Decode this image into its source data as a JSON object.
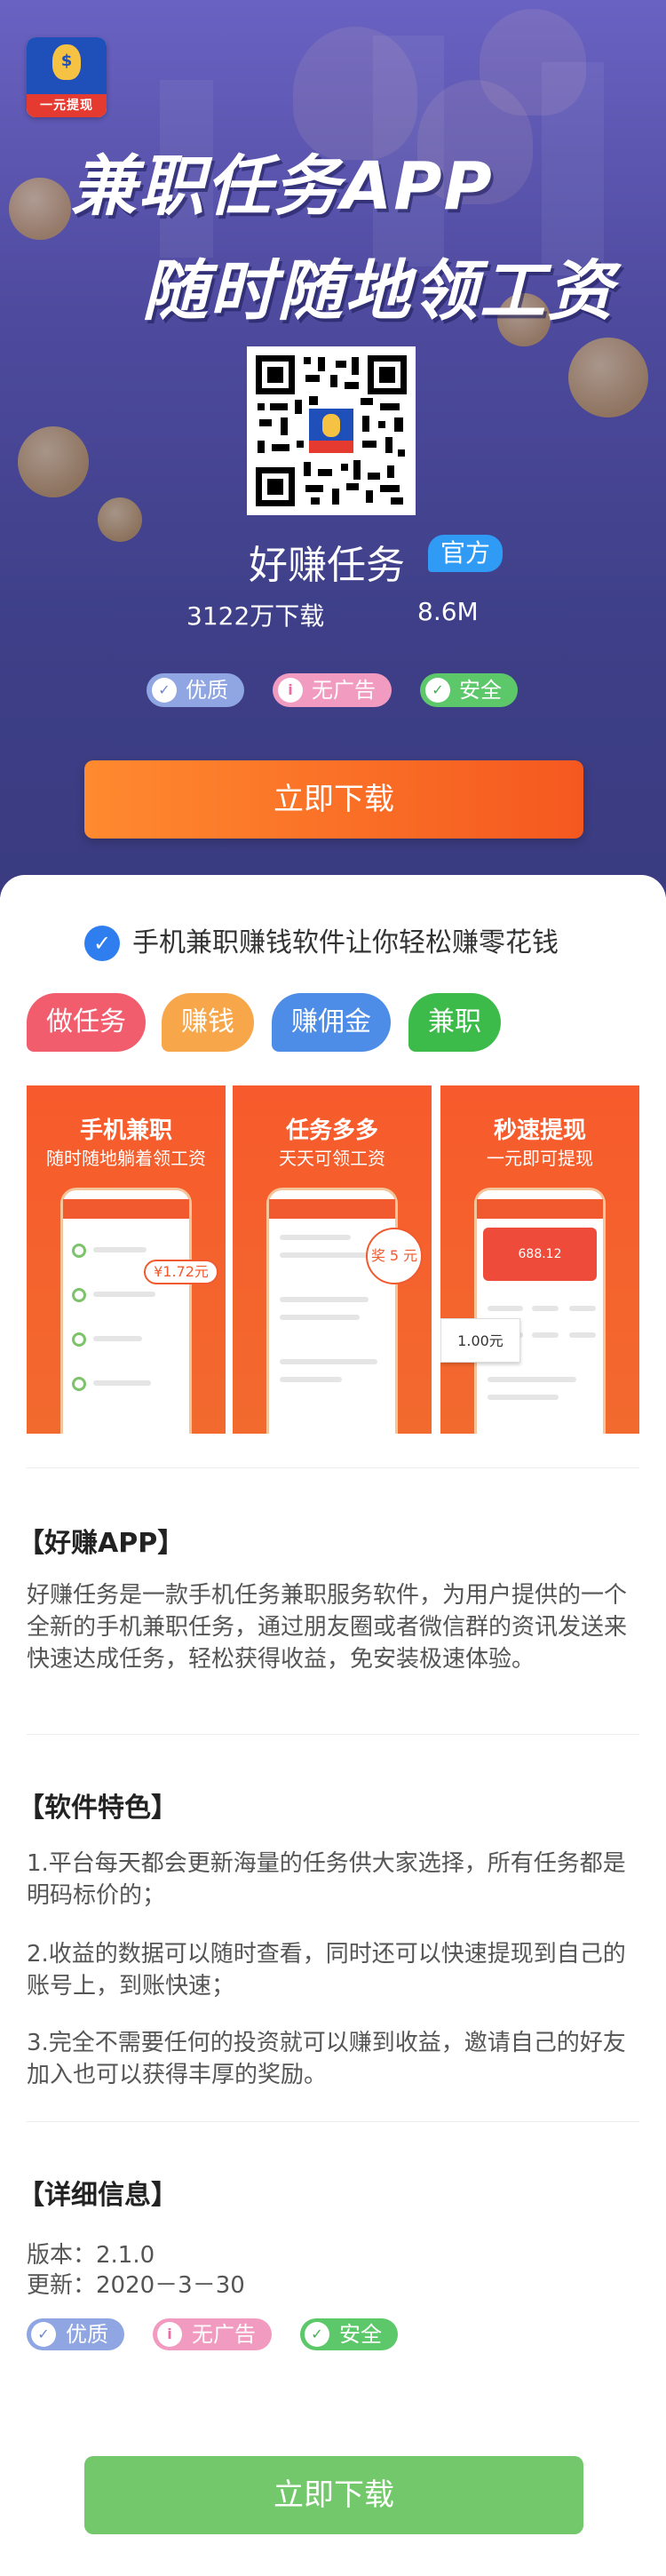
{
  "header": {
    "logo_text": "一元提现",
    "title_line1": "兼职任务APP",
    "title_line2": "随时随地领工资"
  },
  "app": {
    "name": "好赚任务",
    "official_badge": "官方",
    "downloads": "3122万下载",
    "size": "8.6M"
  },
  "badges": {
    "quality": "优质",
    "no_ads": "无广告",
    "safe": "安全"
  },
  "download_button": "立即下载",
  "slogan": "手机兼职赚钱软件让你轻松赚零花钱",
  "tags": [
    "做任务",
    "赚钱",
    "赚佣金",
    "兼职"
  ],
  "screenshots": [
    {
      "title": "手机兼职",
      "subtitle": "随时随地躺着领工资",
      "price": "¥1.72元"
    },
    {
      "title": "任务多多",
      "subtitle": "天天可领工资",
      "badge": "奖 5 元"
    },
    {
      "title": "秒速提现",
      "subtitle": "一元即可提现",
      "amount": "688.12",
      "option": "1.00元"
    }
  ],
  "about": {
    "title": "【好赚APP】",
    "text": "好赚任务是一款手机任务兼职服务软件，为用户提供的一个全新的手机兼职任务，通过朋友圈或者微信群的资讯发送来快速达成任务，轻松获得收益，免安装极速体验。"
  },
  "features": {
    "title": "【软件特色】",
    "items": [
      "1.平台每天都会更新海量的任务供大家选择，所有任务都是明码标价的；",
      "2.收益的数据可以随时查看，同时还可以快速提现到自己的账号上，到账快速；",
      "3.完全不需要任何的投资就可以赚到收益，邀请自己的好友加入也可以获得丰厚的奖励。"
    ]
  },
  "details": {
    "title": "【详细信息】",
    "version": "版本：2.1.0",
    "updated": "更新：2020－3－30"
  },
  "icons": {
    "quality": "shield-icon",
    "no_ads": "info-icon",
    "safe": "check-icon",
    "verified": "verified-icon"
  },
  "colors": {
    "primary_orange": "#f5581f",
    "green_button": "#72c86a",
    "hero_bg": "#4e4a9e"
  }
}
